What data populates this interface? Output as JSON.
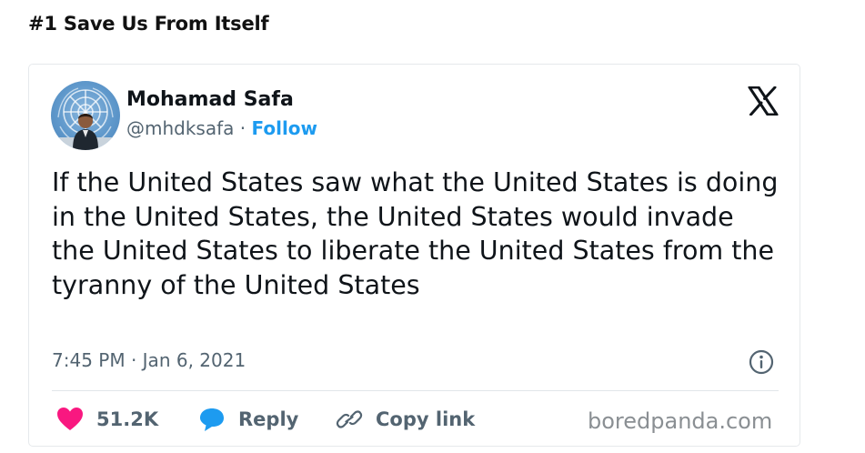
{
  "post": {
    "title": "#1 Save Us From Itself"
  },
  "tweet": {
    "author_name": "Mohamad Safa",
    "handle": "@mhdksafa",
    "separator": "·",
    "follow_label": "Follow",
    "text": "If the United States saw what the United States is doing in the United States, the United States would invade the United States to liberate the United States from the tyranny of the United States",
    "timestamp": "7:45 PM · Jan 6, 2021",
    "platform_icon": "x-logo-icon",
    "info_icon": "info-icon"
  },
  "actions": {
    "like_count": "51.2K",
    "reply_label": "Reply",
    "copy_link_label": "Copy link"
  },
  "watermark": "boredpanda.com",
  "colors": {
    "like": "#f91880",
    "reply": "#1d9bf0",
    "follow": "#1d9bf0",
    "secondary_text": "#536471"
  }
}
